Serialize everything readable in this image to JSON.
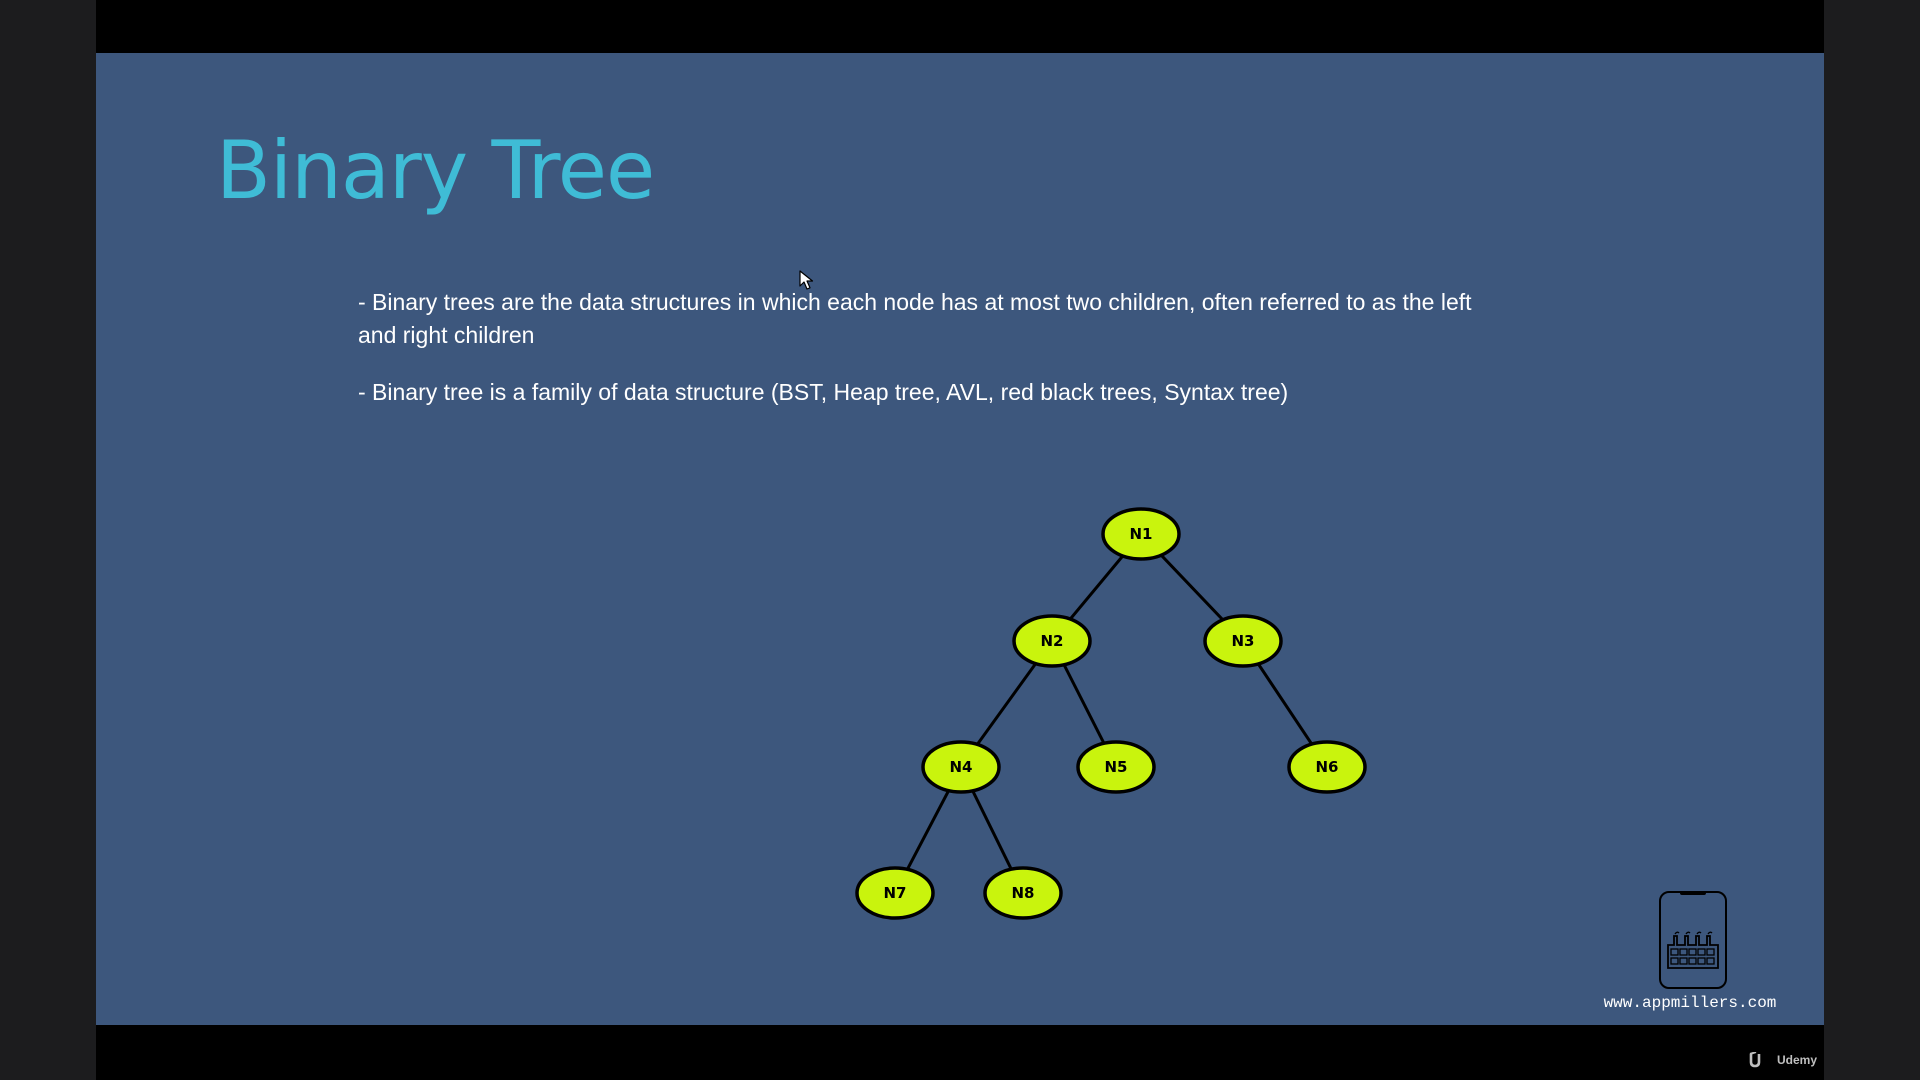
{
  "slide": {
    "title": "Binary Tree",
    "bullets": [
      "- Binary trees are the data structures in which each node has at most two children, often referred to as the left and right children",
      "- Binary tree is a family of data structure (BST, Heap tree, AVL, red black trees, Syntax tree)"
    ],
    "site_url": "www.appmillers.com"
  },
  "tree": {
    "nodes": [
      {
        "id": "N1",
        "label": "N1",
        "children": [
          "N2",
          "N3"
        ]
      },
      {
        "id": "N2",
        "label": "N2",
        "children": [
          "N4",
          "N5"
        ]
      },
      {
        "id": "N3",
        "label": "N3",
        "children": [
          "N6"
        ]
      },
      {
        "id": "N4",
        "label": "N4",
        "children": [
          "N7",
          "N8"
        ]
      },
      {
        "id": "N5",
        "label": "N5",
        "children": []
      },
      {
        "id": "N6",
        "label": "N6",
        "children": []
      },
      {
        "id": "N7",
        "label": "N7",
        "children": []
      },
      {
        "id": "N8",
        "label": "N8",
        "children": []
      }
    ]
  },
  "player": {
    "watermark": "Udemy"
  },
  "colors": {
    "slide_background": "#3d577d",
    "title": "#3fbcd6",
    "node_fill": "#c9f40d",
    "text": "#ffffff"
  },
  "icons": {
    "logo": "phone-factory-logo-icon",
    "cursor": "mouse-cursor-icon",
    "watermark": "udemy-logo-icon"
  }
}
